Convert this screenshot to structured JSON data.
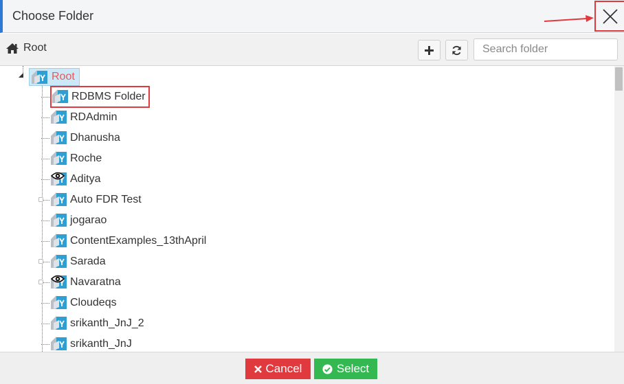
{
  "dialog": {
    "title": "Choose Folder"
  },
  "toolbar": {
    "breadcrumb": "Root",
    "search_placeholder": "Search folder"
  },
  "tree": {
    "root_label": "Root",
    "items": [
      {
        "label": "RDBMS Folder",
        "icon": "folder-icon",
        "selected_outline": true
      },
      {
        "label": "RDAdmin",
        "icon": "folder-icon"
      },
      {
        "label": "Dhanusha",
        "icon": "folder-icon"
      },
      {
        "label": "Roche",
        "icon": "folder-icon"
      },
      {
        "label": "Aditya",
        "icon": "eye-folder-icon"
      },
      {
        "label": "Auto FDR Test",
        "icon": "folder-icon",
        "expandable": true
      },
      {
        "label": "jogarao",
        "icon": "folder-icon"
      },
      {
        "label": "ContentExamples_13thApril",
        "icon": "folder-icon"
      },
      {
        "label": "Sarada",
        "icon": "folder-icon",
        "expandable": true
      },
      {
        "label": "Navaratna",
        "icon": "eye-folder-icon",
        "expandable": true
      },
      {
        "label": "Cloudeqs",
        "icon": "folder-icon"
      },
      {
        "label": "srikanth_JnJ_2",
        "icon": "folder-icon"
      },
      {
        "label": "srikanth_JnJ",
        "icon": "folder-icon"
      }
    ]
  },
  "footer": {
    "cancel_label": "Cancel",
    "select_label": "Select"
  },
  "colors": {
    "accent": "#2d7ad6",
    "annotation_red": "#e0393e",
    "cancel": "#e0393e",
    "select": "#33b852",
    "folder": "#2f9fd3",
    "root_text": "#e35b5b"
  }
}
